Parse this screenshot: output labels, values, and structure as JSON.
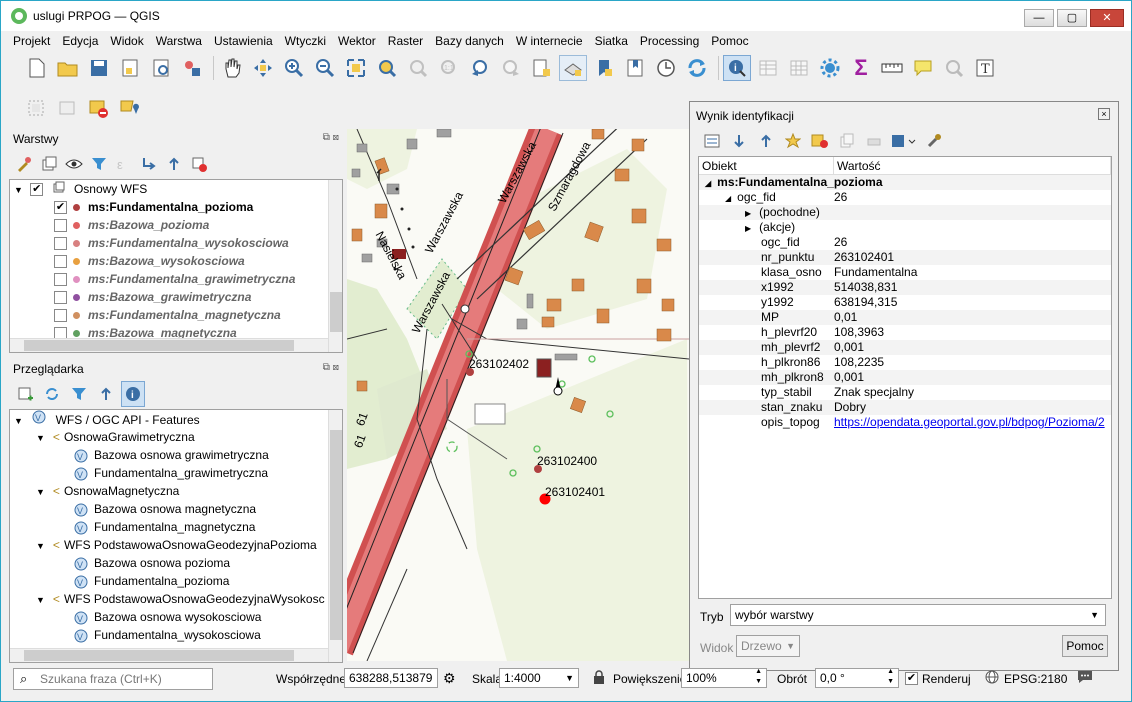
{
  "window": {
    "title": "uslugi PRPOG — QGIS",
    "min_label": "—",
    "max_label": "▢",
    "close_label": "✕"
  },
  "menu": [
    "Projekt",
    "Edycja",
    "Widok",
    "Warstwa",
    "Ustawienia",
    "Wtyczki",
    "Wektor",
    "Raster",
    "Bazy danych",
    "W internecie",
    "Siatka",
    "Processing",
    "Pomoc"
  ],
  "layers_panel": {
    "title": "Warstwy",
    "group": "Osnowy WFS",
    "items": [
      {
        "label": "ms:Fundamentalna_pozioma",
        "checked": true,
        "color": "#b04040"
      },
      {
        "label": "ms:Bazowa_pozioma",
        "checked": false,
        "color": "#e06060"
      },
      {
        "label": "ms:Fundamentalna_wysokosciowa",
        "checked": false,
        "color": "#d88080"
      },
      {
        "label": "ms:Bazowa_wysokosciowa",
        "checked": false,
        "color": "#e8a040"
      },
      {
        "label": "ms:Fundamentalna_grawimetryczna",
        "checked": false,
        "color": "#e090c0"
      },
      {
        "label": "ms:Bazowa_grawimetryczna",
        "checked": false,
        "color": "#9050a0"
      },
      {
        "label": "ms:Fundamentalna_magnetyczna",
        "checked": false,
        "color": "#d09060"
      },
      {
        "label": "ms:Bazowa_magnetyczna",
        "checked": false,
        "color": "#60a060"
      }
    ]
  },
  "browser_panel": {
    "title": "Przeglądarka",
    "root": "WFS / OGC API - Features",
    "groups": [
      {
        "name": "OsnowaGrawimetryczna",
        "items": [
          "Bazowa osnowa grawimetryczna",
          "Fundamentalna_grawimetryczna"
        ]
      },
      {
        "name": "OsnowaMagnetyczna",
        "items": [
          "Bazowa osnowa magnetyczna",
          "Fundamentalna_magnetyczna"
        ]
      },
      {
        "name": "WFS PodstawowaOsnowaGeodezyjnaPozioma",
        "items": [
          "Bazowa osnowa pozioma",
          "Fundamentalna_pozioma"
        ]
      },
      {
        "name": "WFS PodstawowaOsnowaGeodezyjnaWysokosc",
        "items": [
          "Bazowa osnowa wysokosciowa",
          "Fundamentalna_wysokosciowa"
        ]
      }
    ]
  },
  "map": {
    "street_labels": [
      "Nasielska",
      "Warszawska",
      "Warszawska",
      "Szmaragdowa",
      "Warszawska",
      "61",
      "61"
    ],
    "points": [
      {
        "label": "263102402"
      },
      {
        "label": "263102400"
      },
      {
        "label": "263102401"
      }
    ]
  },
  "identify": {
    "title": "Wynik identyfikacji",
    "col_object": "Obiekt",
    "col_value": "Wartość",
    "layer": "ms:Fundamentalna_pozioma",
    "feature_key": "ogc_fid",
    "feature_val": "26",
    "expanders": [
      "(pochodne)",
      "(akcje)"
    ],
    "attributes": [
      {
        "k": "ogc_fid",
        "v": "26"
      },
      {
        "k": "nr_punktu",
        "v": "263102401"
      },
      {
        "k": "klasa_osno",
        "v": "Fundamentalna"
      },
      {
        "k": "x1992",
        "v": "514038,831"
      },
      {
        "k": "y1992",
        "v": "638194,315"
      },
      {
        "k": "MP",
        "v": "0,01"
      },
      {
        "k": "h_plevrf20",
        "v": "108,3963"
      },
      {
        "k": "mh_plevrf2",
        "v": "0,001"
      },
      {
        "k": "h_plkron86",
        "v": "108,2235"
      },
      {
        "k": "mh_plkron8",
        "v": "0,001"
      },
      {
        "k": "typ_stabil",
        "v": "Znak specjalny"
      },
      {
        "k": "stan_znaku",
        "v": "Dobry"
      }
    ],
    "link_key": "opis_topog",
    "link_val": "https://opendata.geoportal.gov.pl/bdpog/Pozioma/2",
    "mode_label": "Tryb",
    "mode_value": "wybór warstwy",
    "view_label": "Widok",
    "view_value": "Drzewo",
    "help_button": "Pomoc"
  },
  "status": {
    "search_placeholder": "Szukana fraza (Ctrl+K)",
    "coord_label": "Współrzędne",
    "coord_value": "638288,513879",
    "scale_label": "Skala",
    "scale_value": "1:4000",
    "zoom_label": "Powiększenie",
    "zoom_value": "100%",
    "rotation_label": "Obrót",
    "rotation_value": "0,0 °",
    "render_label": "Renderuj",
    "crs": "EPSG:2180"
  }
}
